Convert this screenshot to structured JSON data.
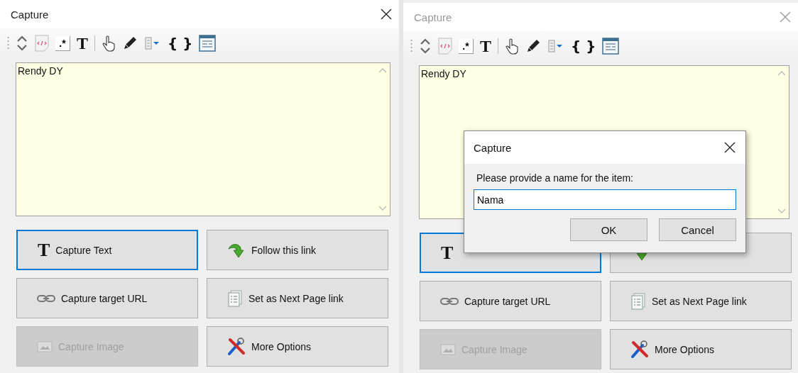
{
  "panels": [
    {
      "title": "Capture",
      "active": true,
      "toolbar": [
        {
          "kind": "updown"
        },
        {
          "kind": "html"
        },
        {
          "kind": "regex",
          "text": ".*"
        },
        {
          "kind": "glyph",
          "text": "T"
        },
        {
          "kind": "separator"
        },
        {
          "kind": "hand"
        },
        {
          "kind": "pencil"
        },
        {
          "kind": "dropdown"
        },
        {
          "kind": "glyph",
          "text": "{ }"
        },
        {
          "kind": "form"
        }
      ],
      "text": "Rendy DY",
      "buttons": [
        {
          "kind": "text",
          "glyph": "T",
          "label": "Capture Text",
          "focused": true,
          "disabled": false
        },
        {
          "kind": "follow",
          "label": "Follow this link",
          "focused": false,
          "disabled": false
        },
        {
          "kind": "url",
          "label": "Capture target URL",
          "focused": false,
          "disabled": false
        },
        {
          "kind": "nextpage",
          "label": "Set as Next Page link",
          "focused": false,
          "disabled": false
        },
        {
          "kind": "image",
          "label": "Capture Image",
          "focused": false,
          "disabled": true
        },
        {
          "kind": "options",
          "label": "More Options",
          "focused": false,
          "disabled": false
        }
      ]
    },
    {
      "title": "Capture",
      "active": false,
      "toolbar": [
        {
          "kind": "updown"
        },
        {
          "kind": "html"
        },
        {
          "kind": "regex",
          "text": ".*"
        },
        {
          "kind": "glyph",
          "text": "T"
        },
        {
          "kind": "separator"
        },
        {
          "kind": "hand"
        },
        {
          "kind": "pencil"
        },
        {
          "kind": "dropdown"
        },
        {
          "kind": "glyph",
          "text": "{ }"
        },
        {
          "kind": "form"
        }
      ],
      "text": "Rendy DY",
      "buttons": [
        {
          "kind": "text",
          "glyph": "T",
          "focused": true,
          "disabled": false
        },
        {
          "kind": "follow",
          "focused": false,
          "disabled": false
        },
        {
          "kind": "url",
          "label": "Capture target URL",
          "focused": false,
          "disabled": false
        },
        {
          "kind": "nextpage",
          "label": "Set as Next Page link",
          "focused": false,
          "disabled": false
        },
        {
          "kind": "image",
          "label": "Capture Image",
          "focused": false,
          "disabled": true
        },
        {
          "kind": "options",
          "label": "More Options",
          "focused": false,
          "disabled": false
        }
      ]
    }
  ],
  "dialog": {
    "title": "Capture",
    "prompt": "Please provide a name for the item:",
    "value": "Nama",
    "buttons": [
      "OK",
      "Cancel"
    ]
  }
}
